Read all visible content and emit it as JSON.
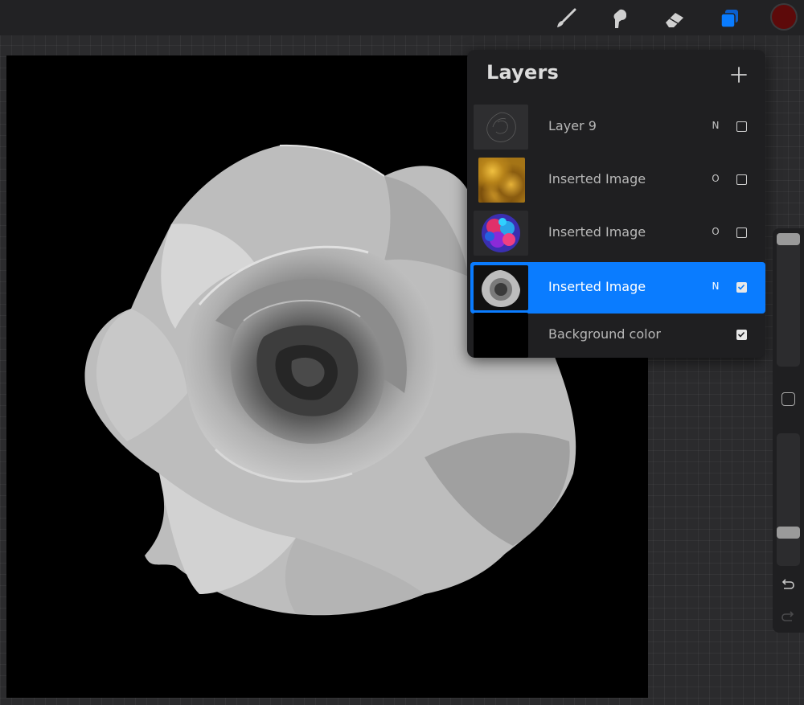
{
  "toolbar": {
    "tools": [
      {
        "name": "brush",
        "icon": "brush-icon",
        "active": false
      },
      {
        "name": "smudge",
        "icon": "smudge-icon",
        "active": false
      },
      {
        "name": "eraser",
        "icon": "eraser-icon",
        "active": false
      },
      {
        "name": "layers",
        "icon": "layers-icon",
        "active": true
      }
    ],
    "active_color": "#5d0a0a",
    "accent_color": "#0a7cff"
  },
  "layers_panel": {
    "title": "Layers",
    "add_icon": "plus-icon",
    "layers": [
      {
        "name": "Layer 9",
        "blend": "N",
        "visible": false,
        "selected": false,
        "thumb": "rose-sketch"
      },
      {
        "name": "Inserted Image",
        "blend": "O",
        "visible": false,
        "selected": false,
        "thumb": "gold-texture"
      },
      {
        "name": "Inserted Image",
        "blend": "O",
        "visible": false,
        "selected": false,
        "thumb": "colorful-texture"
      },
      {
        "name": "Inserted Image",
        "blend": "N",
        "visible": true,
        "selected": true,
        "thumb": "rose-photo"
      },
      {
        "name": "Background color",
        "blend": "",
        "visible": true,
        "selected": false,
        "thumb": "black"
      }
    ]
  },
  "sidebar": {
    "brush_size": 1.0,
    "brush_opacity": 0.22,
    "undo_icon": "undo-icon",
    "redo_icon": "redo-icon"
  }
}
